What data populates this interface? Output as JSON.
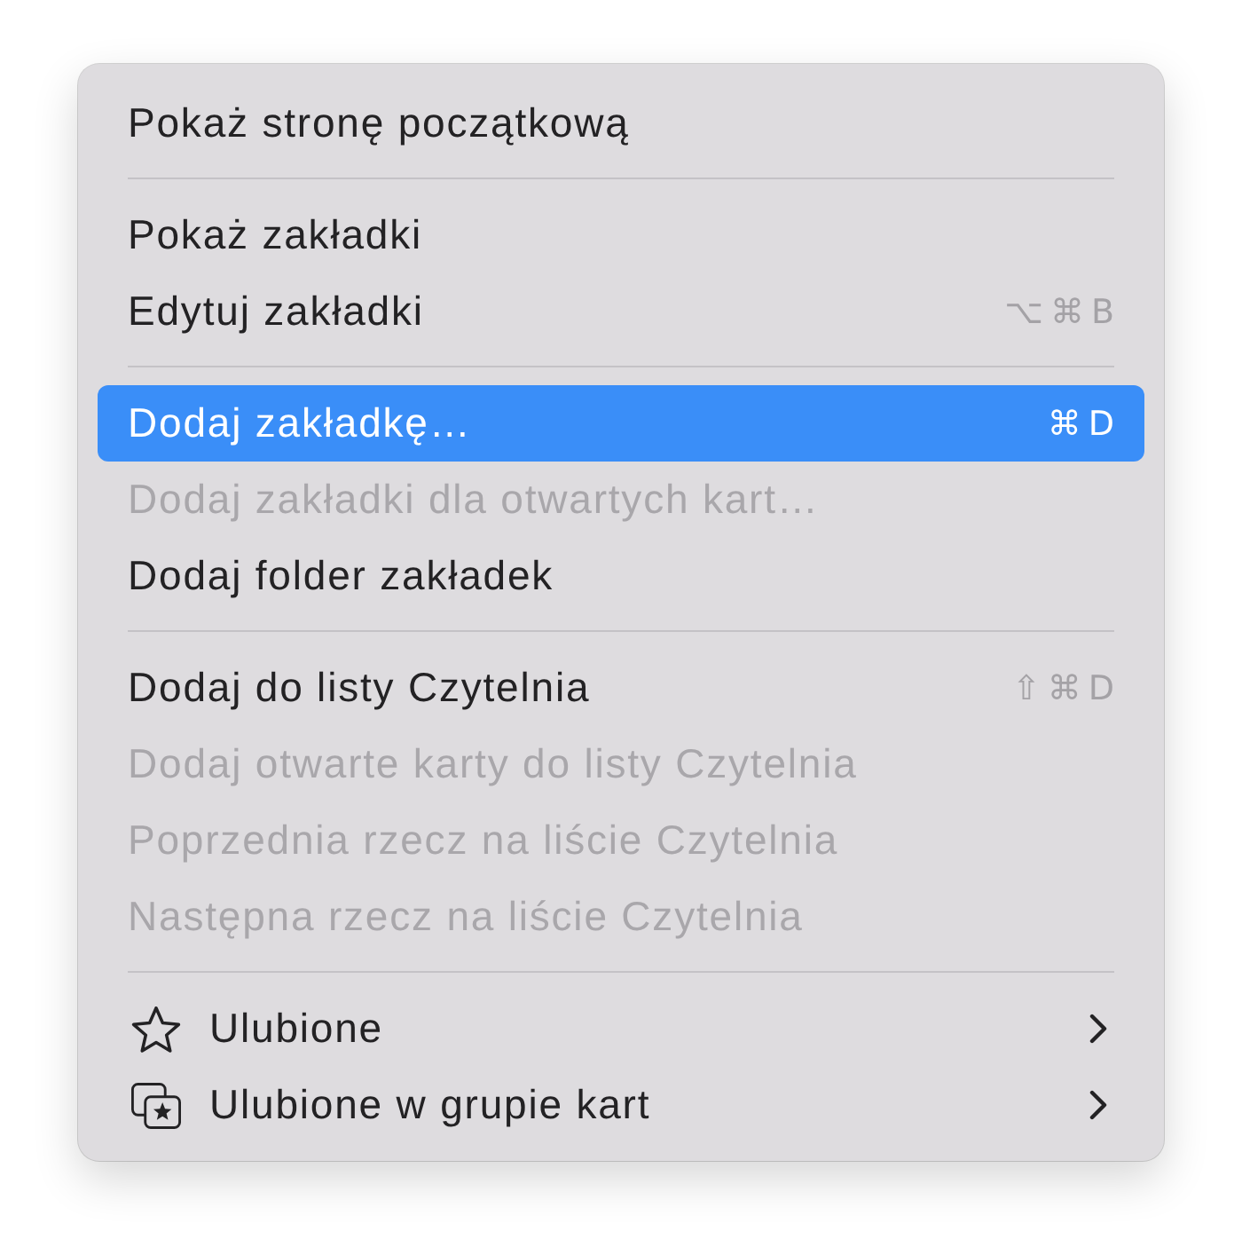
{
  "menu": {
    "groups": [
      {
        "items": [
          {
            "kind": "plain",
            "label": "Pokaż stronę początkową",
            "selected": false,
            "disabled": false,
            "submenu": false
          }
        ]
      },
      {
        "items": [
          {
            "kind": "plain",
            "label": "Pokaż zakładki",
            "selected": false,
            "disabled": false,
            "submenu": false
          },
          {
            "kind": "plain",
            "label": "Edytuj zakładki",
            "shortcut": "⌥⌘B",
            "selected": false,
            "disabled": false,
            "submenu": false
          }
        ]
      },
      {
        "items": [
          {
            "kind": "plain",
            "label": "Dodaj zakładkę…",
            "shortcut": "⌘D",
            "selected": true,
            "disabled": false,
            "submenu": false
          },
          {
            "kind": "plain",
            "label": "Dodaj zakładki dla otwartych kart…",
            "selected": false,
            "disabled": true,
            "submenu": false
          },
          {
            "kind": "plain",
            "label": "Dodaj folder zakładek",
            "selected": false,
            "disabled": false,
            "submenu": false
          }
        ]
      },
      {
        "items": [
          {
            "kind": "plain",
            "label": "Dodaj do listy Czytelnia",
            "shortcut": "⇧⌘D",
            "selected": false,
            "disabled": false,
            "submenu": false
          },
          {
            "kind": "plain",
            "label": "Dodaj otwarte karty do listy Czytelnia",
            "selected": false,
            "disabled": true,
            "submenu": false
          },
          {
            "kind": "plain",
            "label": "Poprzednia rzecz na liście Czytelnia",
            "selected": false,
            "disabled": true,
            "submenu": false
          },
          {
            "kind": "plain",
            "label": "Następna rzecz na liście Czytelnia",
            "selected": false,
            "disabled": true,
            "submenu": false
          }
        ]
      },
      {
        "items": [
          {
            "kind": "favorites",
            "label": "Ulubione",
            "selected": false,
            "disabled": false,
            "submenu": true
          },
          {
            "kind": "tabgroup",
            "label": "Ulubione w grupie kart",
            "selected": false,
            "disabled": false,
            "submenu": true
          }
        ]
      }
    ]
  }
}
